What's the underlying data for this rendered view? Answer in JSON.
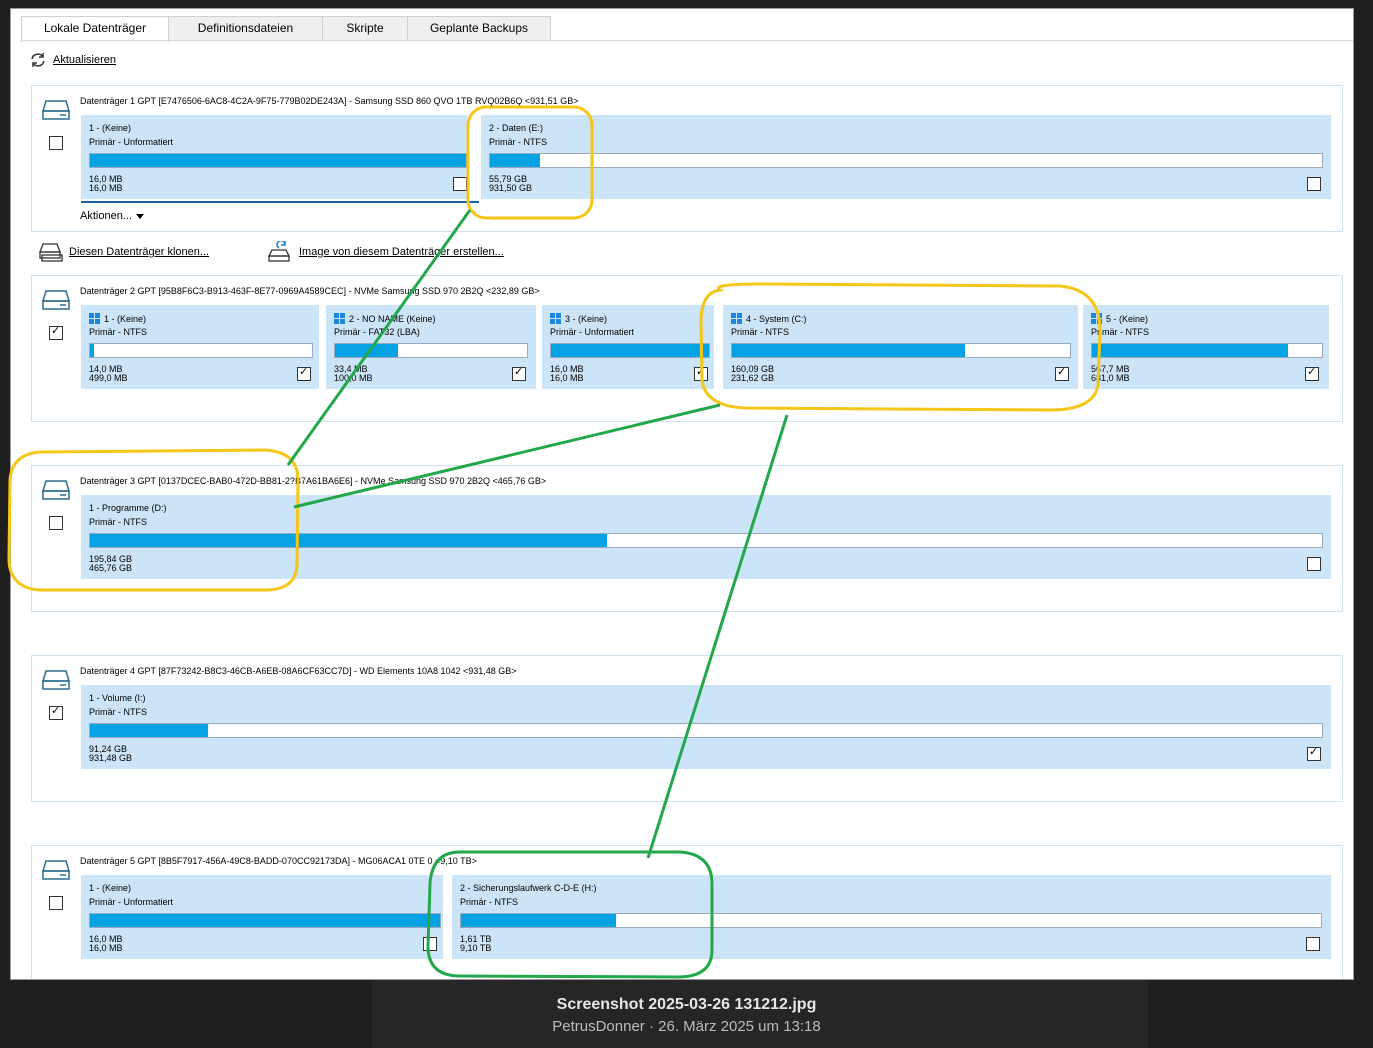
{
  "tabs": [
    "Lokale Datenträger",
    "Definitionsdateien",
    "Skripte",
    "Geplante Backups"
  ],
  "refresh_label": "Aktualisieren",
  "actions_label": "Aktionen...",
  "clone_label": "Diesen Datenträger klonen...",
  "image_label": "Image von diesem Datenträger erstellen...",
  "disks": [
    {
      "header": "Datenträger 1 GPT [E7476506-6AC8-4C2A-9F75-779B02DE243A] - Samsung SSD 860 QVO 1TB RVQ02B6Q  <931,51 GB>",
      "checked": false,
      "partitions": [
        {
          "name": "1 -  (Keine)",
          "type": "Primär - Unformatiert",
          "used": "16,0 MB",
          "total": "16,0 MB",
          "fill": 1.0,
          "checked": false,
          "win": false
        },
        {
          "name": "2 - Daten (E:)",
          "type": "Primär - NTFS",
          "used": "55,79 GB",
          "total": "931,50 GB",
          "fill": 0.06,
          "checked": false,
          "win": false
        }
      ]
    },
    {
      "header": "Datenträger 2 GPT [95B8F6C3-B913-463F-8E77-0969A4589CEC] - NVMe    Samsung SSD 970  2B2Q  <232,89 GB>",
      "checked": true,
      "partitions": [
        {
          "name": "1 -  (Keine)",
          "type": "Primär - NTFS",
          "used": "14,0 MB",
          "total": "499,0 MB",
          "fill": 0.02,
          "checked": true,
          "win": true
        },
        {
          "name": "2 - NO NAME (Keine)",
          "type": "Primär - FAT32 (LBA)",
          "used": "33,4 MB",
          "total": "100,0 MB",
          "fill": 0.33,
          "checked": true,
          "win": true
        },
        {
          "name": "3 -  (Keine)",
          "type": "Primär - Unformatiert",
          "used": "16,0 MB",
          "total": "16,0 MB",
          "fill": 1.0,
          "checked": true,
          "win": true
        },
        {
          "name": "4 - System (C:)",
          "type": "Primär - NTFS",
          "used": "160,09 GB",
          "total": "231,62 GB",
          "fill": 0.69,
          "checked": true,
          "win": true
        },
        {
          "name": "5 -  (Keine)",
          "type": "Primär - NTFS",
          "used": "567,7 MB",
          "total": "681,0 MB",
          "fill": 0.85,
          "checked": true,
          "win": true
        }
      ]
    },
    {
      "header": "Datenträger 3 GPT [0137DCEC-BAB0-472D-BB81-2?B7A61BA6E6] - NVMe    Samsung SSD 970  2B2Q  <465,76 GB>",
      "checked": false,
      "partitions": [
        {
          "name": "1 - Programme (D:)",
          "type": "Primär - NTFS",
          "used": "195,84 GB",
          "total": "465,76 GB",
          "fill": 0.42,
          "checked": false,
          "win": false
        }
      ]
    },
    {
      "header": "Datenträger 4 GPT [87F73242-B8C3-46CB-A6EB-08A6CF63CC7D] - WD      Elements 10A8    1042  <931,48 GB>",
      "checked": true,
      "partitions": [
        {
          "name": "1 - Volume (I:)",
          "type": "Primär - NTFS",
          "used": "91,24 GB",
          "total": "931,48 GB",
          "fill": 0.096,
          "checked": true,
          "win": false
        }
      ]
    },
    {
      "header": "Datenträger 5 GPT [8B5F7917-456A-49C8-BADD-070CC92173DA] - MG06ACA1 0TE         0  <9,10 TB>",
      "checked": false,
      "partitions": [
        {
          "name": "1 -  (Keine)",
          "type": "Primär - Unformatiert",
          "used": "16,0 MB",
          "total": "16,0 MB",
          "fill": 1.0,
          "checked": false,
          "win": false
        },
        {
          "name": "2 - Sicherungslaufwerk C-D-E (H:)",
          "type": "Primär - NTFS",
          "used": "1,61 TB",
          "total": "9,10 TB",
          "fill": 0.18,
          "checked": false,
          "win": false
        }
      ]
    }
  ],
  "caption_title": "Screenshot 2025-03-26 131212.jpg",
  "caption_sub": "PetrusDonner · 26. März 2025 um 13:18",
  "colors": {
    "bar_fill": "#06a3e4",
    "partition_bg": "#cce4f7",
    "annotation_yellow": "#f5c518",
    "annotation_green": "#22a84a"
  }
}
